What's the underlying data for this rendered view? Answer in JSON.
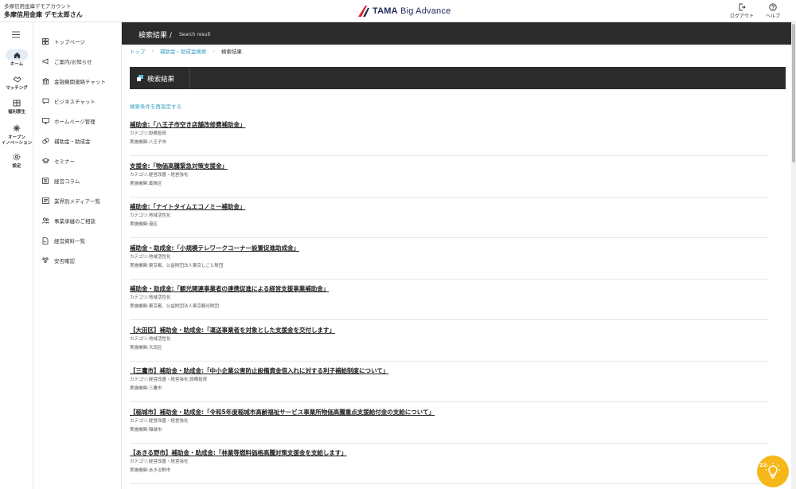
{
  "header": {
    "account_label": "多摩信用金庫デモアカウント",
    "account_name": "多摩信用金庫 デモ太郎さん",
    "logo_text_bold": "TAMA",
    "logo_text": "Big Advance",
    "logout_label": "ログアウト",
    "help_label": "ヘルプ"
  },
  "rail": [
    {
      "label_lines": [
        "ホーム"
      ],
      "icon": "home-icon",
      "active": true
    },
    {
      "label_lines": [
        "マッチング"
      ],
      "icon": "handshake-icon"
    },
    {
      "label_lines": [
        "福利厚生"
      ],
      "icon": "gift-card-icon"
    },
    {
      "label_lines": [
        "オープン",
        "イノベーション"
      ],
      "icon": "sparkle-icon"
    },
    {
      "label_lines": [
        "設定"
      ],
      "icon": "gear-icon"
    }
  ],
  "sidebar": [
    {
      "label": "トップページ",
      "icon": "grid-icon"
    },
    {
      "label": "ご案内/お知らせ",
      "icon": "megaphone-icon"
    },
    {
      "label": "金融機関連絡チャット",
      "icon": "bank-icon"
    },
    {
      "label": "ビジネスチャット",
      "icon": "chat-bubble-icon"
    },
    {
      "label": "ホームページ管理",
      "icon": "monitor-icon"
    },
    {
      "label": "補助金・助成金",
      "icon": "coins-icon"
    },
    {
      "label": "セミナー",
      "icon": "graduation-cap-icon"
    },
    {
      "label": "経営コラム",
      "icon": "column-icon"
    },
    {
      "label": "業界別メディア一覧",
      "icon": "newspaper-icon"
    },
    {
      "label": "事業承継のご相談",
      "icon": "people-icon"
    },
    {
      "label": "経営資料一覧",
      "icon": "document-icon"
    },
    {
      "label": "安否確認",
      "icon": "safety-check-icon"
    }
  ],
  "page": {
    "title": "検索結果 /",
    "title_en": "Search result",
    "breadcrumbs": [
      "トップ",
      "補助金・助成金検索",
      "検索結果"
    ],
    "heading": "検索結果",
    "reset_link": "検索条件を再設定する"
  },
  "results": [
    {
      "title": "補助金:「八王子市空き店舗改修費補助金」",
      "category": "カテゴリ:設備投資",
      "org": "実施機関:八王子市"
    },
    {
      "title": "支援金:「物価高騰緊急対策支援金」",
      "category": "カテゴリ:経営改善・経営強化",
      "org": "実施機関:葛飾区"
    },
    {
      "title": "補助金:「ナイトタイムエコノミー補助金」",
      "category": "カテゴリ:地域活性化",
      "org": "実施機関:港区"
    },
    {
      "title": "補助金・助成金:「小規模テレワークコーナー設置促進助成金」",
      "category": "カテゴリ:地域活性化",
      "org": "実施機関:東京都、公益財団法人東京しごと財団"
    },
    {
      "title": "補助金・助成金:「観光関連事業者の連携促進による経営支援事業補助金」",
      "category": "カテゴリ:地域活性化",
      "org": "実施機関:東京都、公益財団法人東京観光財団"
    },
    {
      "title": "【大田区】補助金・助成金:「運送事業者を対象とした支援金を交付します」",
      "category": "カテゴリ:地域活性化",
      "org": "実施機関:大田区"
    },
    {
      "title": "【三鷹市】補助金・助成金:「中小企業公害防止設備資金借入れに対する利子補給制度について」",
      "category": "カテゴリ:経営改善・経営強化,設備投資",
      "org": "実施機関:三鷹市"
    },
    {
      "title": "【稲城市】補助金・助成金:「令和5年度稲城市高齢福祉サービス事業所物価高騰重点支援給付金の支給について」",
      "category": "カテゴリ:経営改善・経営強化",
      "org": "実施機関:稲城市"
    },
    {
      "title": "【あきる野市】補助金・助成金:「林業等燃料価格高騰対策支援金を支給します」",
      "category": "カテゴリ:経営改善・経営強化",
      "org": "実施機関:あきる野市"
    }
  ],
  "help_bulb": {
    "count": "22"
  },
  "colors": {
    "accent": "#3a9fc0",
    "dark_bar": "#2b2b2b",
    "bulb": "#f6b718",
    "brand": "#1e2a55",
    "logo_red": "#d6202a"
  }
}
